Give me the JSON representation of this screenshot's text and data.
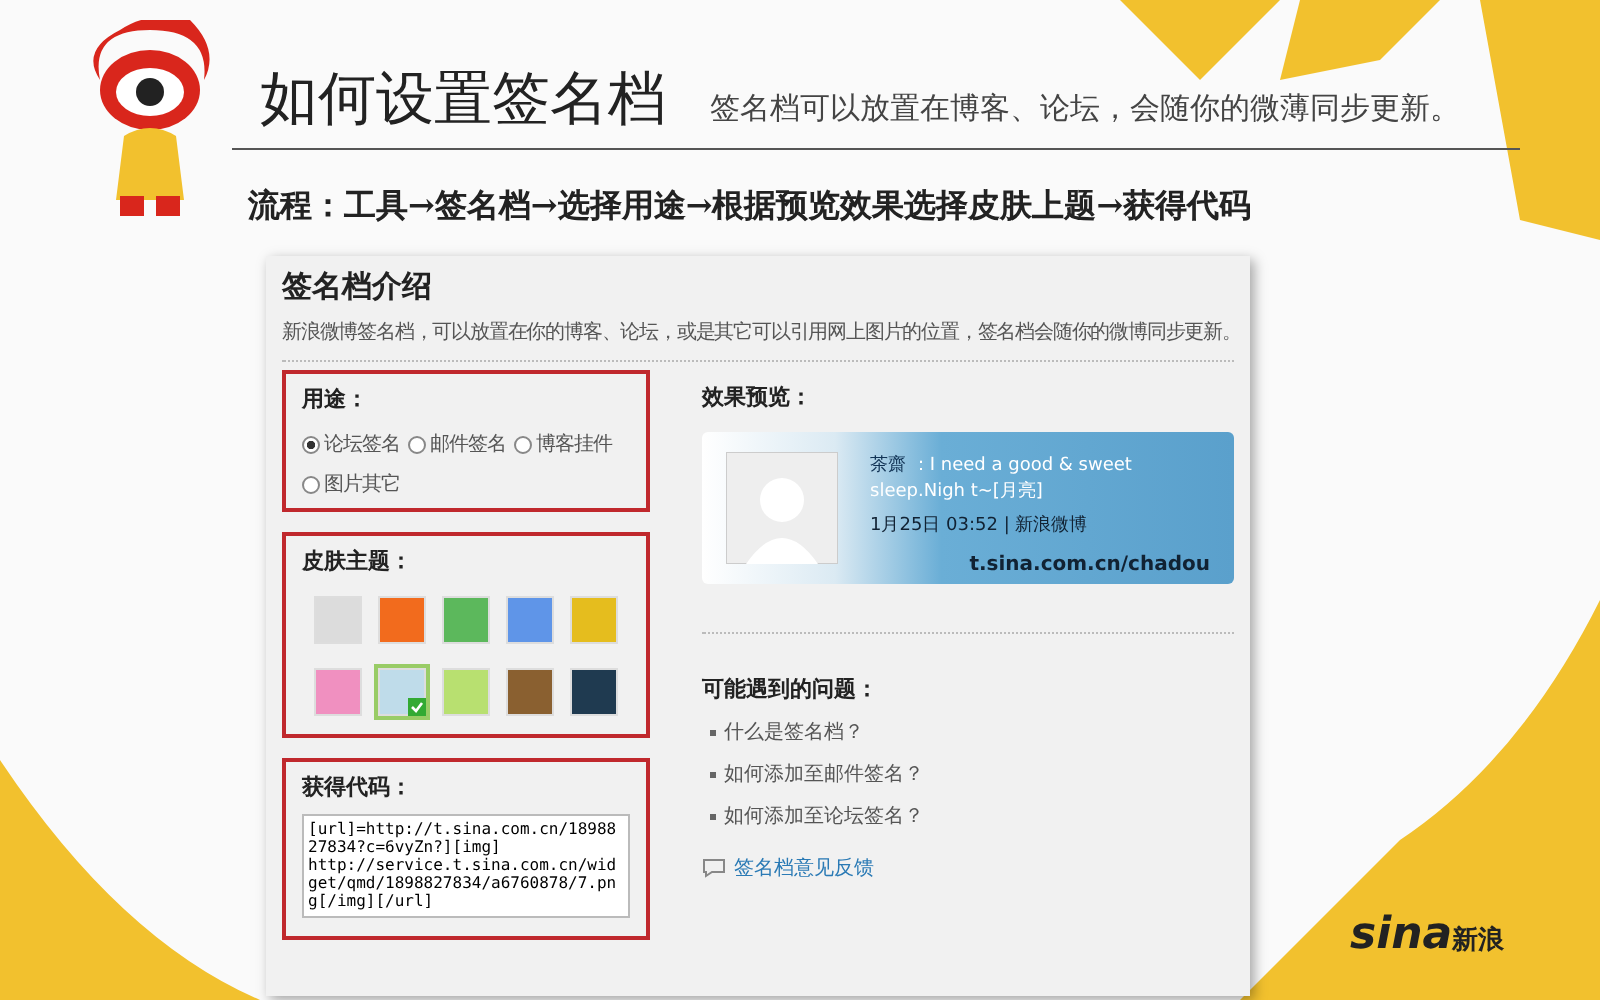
{
  "slide": {
    "title": "如何设置签名档",
    "subtitle": "签名档可以放置在博客、论坛，会随你的微薄同步更新。",
    "flow": "流程：工具→签名档→选择用途→根据预览效果选择皮肤上题→获得代码"
  },
  "panel": {
    "heading": "签名档介绍",
    "intro": "新浪微博签名档，可以放置在你的博客、论坛，或是其它可以引用网上图片的位置，签名档会随你的微博同步更新。",
    "usage": {
      "label": "用途：",
      "options": [
        {
          "label": "论坛签名",
          "selected": true
        },
        {
          "label": "邮件签名",
          "selected": false
        },
        {
          "label": "博客挂件",
          "selected": false
        },
        {
          "label": "图片其它",
          "selected": false
        }
      ]
    },
    "skin": {
      "label": "皮肤主题：",
      "swatches": [
        {
          "color": "#dcdcdc",
          "selected": false
        },
        {
          "color": "#f26b1d",
          "selected": false
        },
        {
          "color": "#5cb85c",
          "selected": false
        },
        {
          "color": "#5f95e8",
          "selected": false
        },
        {
          "color": "#e5bd1e",
          "selected": false
        },
        {
          "color": "#f090c0",
          "selected": false
        },
        {
          "color": "#bfdcea",
          "selected": true
        },
        {
          "color": "#b8e070",
          "selected": false
        },
        {
          "color": "#8a6030",
          "selected": false
        },
        {
          "color": "#1f3a50",
          "selected": false
        }
      ]
    },
    "code": {
      "label": "获得代码：",
      "value": "[url]=http://t.sina.com.cn/1898827834?c=6vyZn?][img] http://service.t.sina.com.cn/widget/qmd/1898827834/a6760878/7.png[/img][/url]"
    },
    "preview": {
      "label": "效果预览：",
      "name": "茶齋",
      "message": "：I need a good & sweet sleep.Nigh t~[月亮]",
      "time": "1月25日 03:52 | 新浪微博",
      "url": "t.sina.com.cn/chadou"
    },
    "faq": {
      "label": "可能遇到的问题：",
      "items": [
        "什么是签名档？",
        "如何添加至邮件签名？",
        "如何添加至论坛签名？"
      ],
      "link": "签名档意见反馈"
    }
  },
  "logo": {
    "brand": "sina",
    "chinese": "新浪"
  }
}
